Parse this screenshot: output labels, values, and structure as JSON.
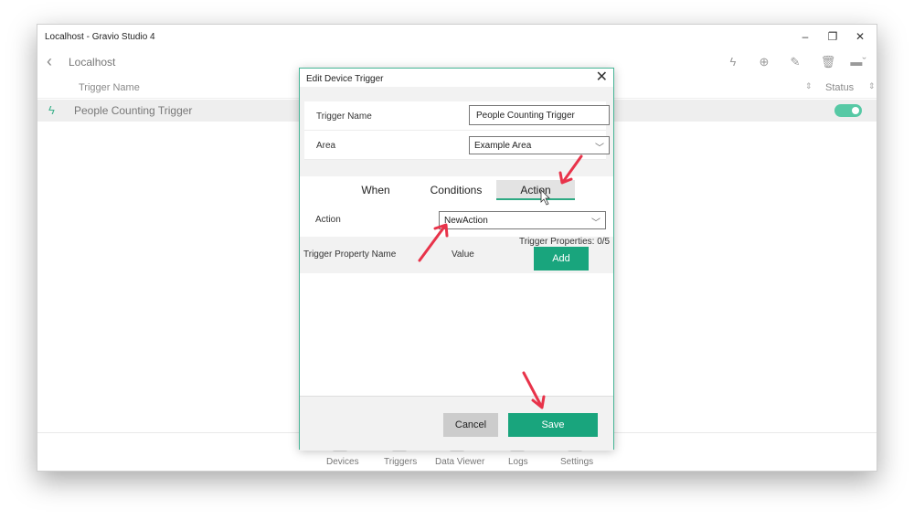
{
  "window": {
    "title": "Localhost - Gravio Studio 4",
    "controls": [
      "–",
      "❐",
      "✕"
    ]
  },
  "navbar": {
    "back_icon": "chevron-left-icon",
    "title": "Localhost"
  },
  "list": {
    "column_trigger_name": "Trigger Name",
    "column_status": "Status",
    "rows": [
      {
        "name": "People Counting Trigger",
        "status_on": true
      }
    ]
  },
  "bottom_nav": {
    "items": [
      "Devices",
      "Triggers",
      "Data Viewer",
      "Logs",
      "Settings"
    ]
  },
  "dialog": {
    "title": "Edit Device Trigger",
    "close": "✕",
    "trigger_name_label": "Trigger Name",
    "trigger_name_value": "People Counting Trigger",
    "area_label": "Area",
    "area_value": "Example Area",
    "tabs": [
      {
        "label": "When",
        "active": false
      },
      {
        "label": "Conditions",
        "active": false
      },
      {
        "label": "Action",
        "active": true
      }
    ],
    "action_label": "Action",
    "action_value": "NewAction",
    "prop_col_name": "Trigger Property Name",
    "prop_col_value": "Value",
    "trigger_properties_count": "Trigger Properties: 0/5",
    "add_label": "Add",
    "cancel_label": "Cancel",
    "save_label": "Save"
  },
  "colors": {
    "accent": "#19a57d",
    "annotation_arrow": "#e8334a",
    "toggle_on": "#57c9a5"
  }
}
